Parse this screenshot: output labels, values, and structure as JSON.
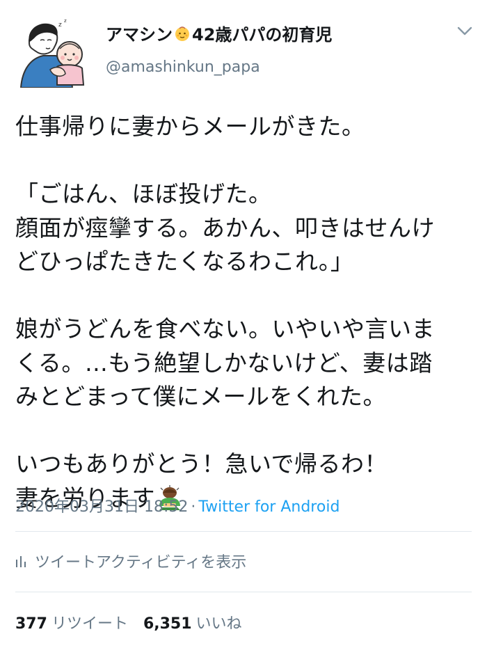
{
  "user": {
    "name_part1": "アマシン",
    "baby_icon": "baby-emoji",
    "name_part2": "42歳パパの初育児",
    "handle": "@amashinkun_papa",
    "avatar_icon": "father-holding-baby-avatar"
  },
  "menu_icon": "chevron-down-icon",
  "tweet": {
    "lines": [
      "仕事帰りに妻からメールがきた。",
      "",
      "「ごはん、ほぼ投げた。",
      "顔面が痙攣する。あかん、叩きはせんけ",
      "どひっぱたきたくなるわこれ。」",
      "",
      "娘がうどんを食べない。いやいや言いま",
      "くる。…もう絶望しかないけど、妻は踏",
      "みとどまって僕にメールをくれた。",
      "",
      "いつもありがとう！急いで帰るわ！",
      "妻を労ります"
    ],
    "trailing_icon": "person-bowing-emoji"
  },
  "meta": {
    "time": "2020年03月31日 18:52",
    "separator": "·",
    "source": "Twitter for Android"
  },
  "activity": {
    "icon": "bar-chart-icon",
    "label": "ツイートアクティビティを表示"
  },
  "stats": {
    "retweets_count": "377",
    "retweets_label": "リツイート",
    "likes_count": "6,351",
    "likes_label": "いいね"
  },
  "colors": {
    "text": "#14171a",
    "secondary": "#657786",
    "link": "#1da1f2",
    "divider": "#e1e8ed"
  }
}
